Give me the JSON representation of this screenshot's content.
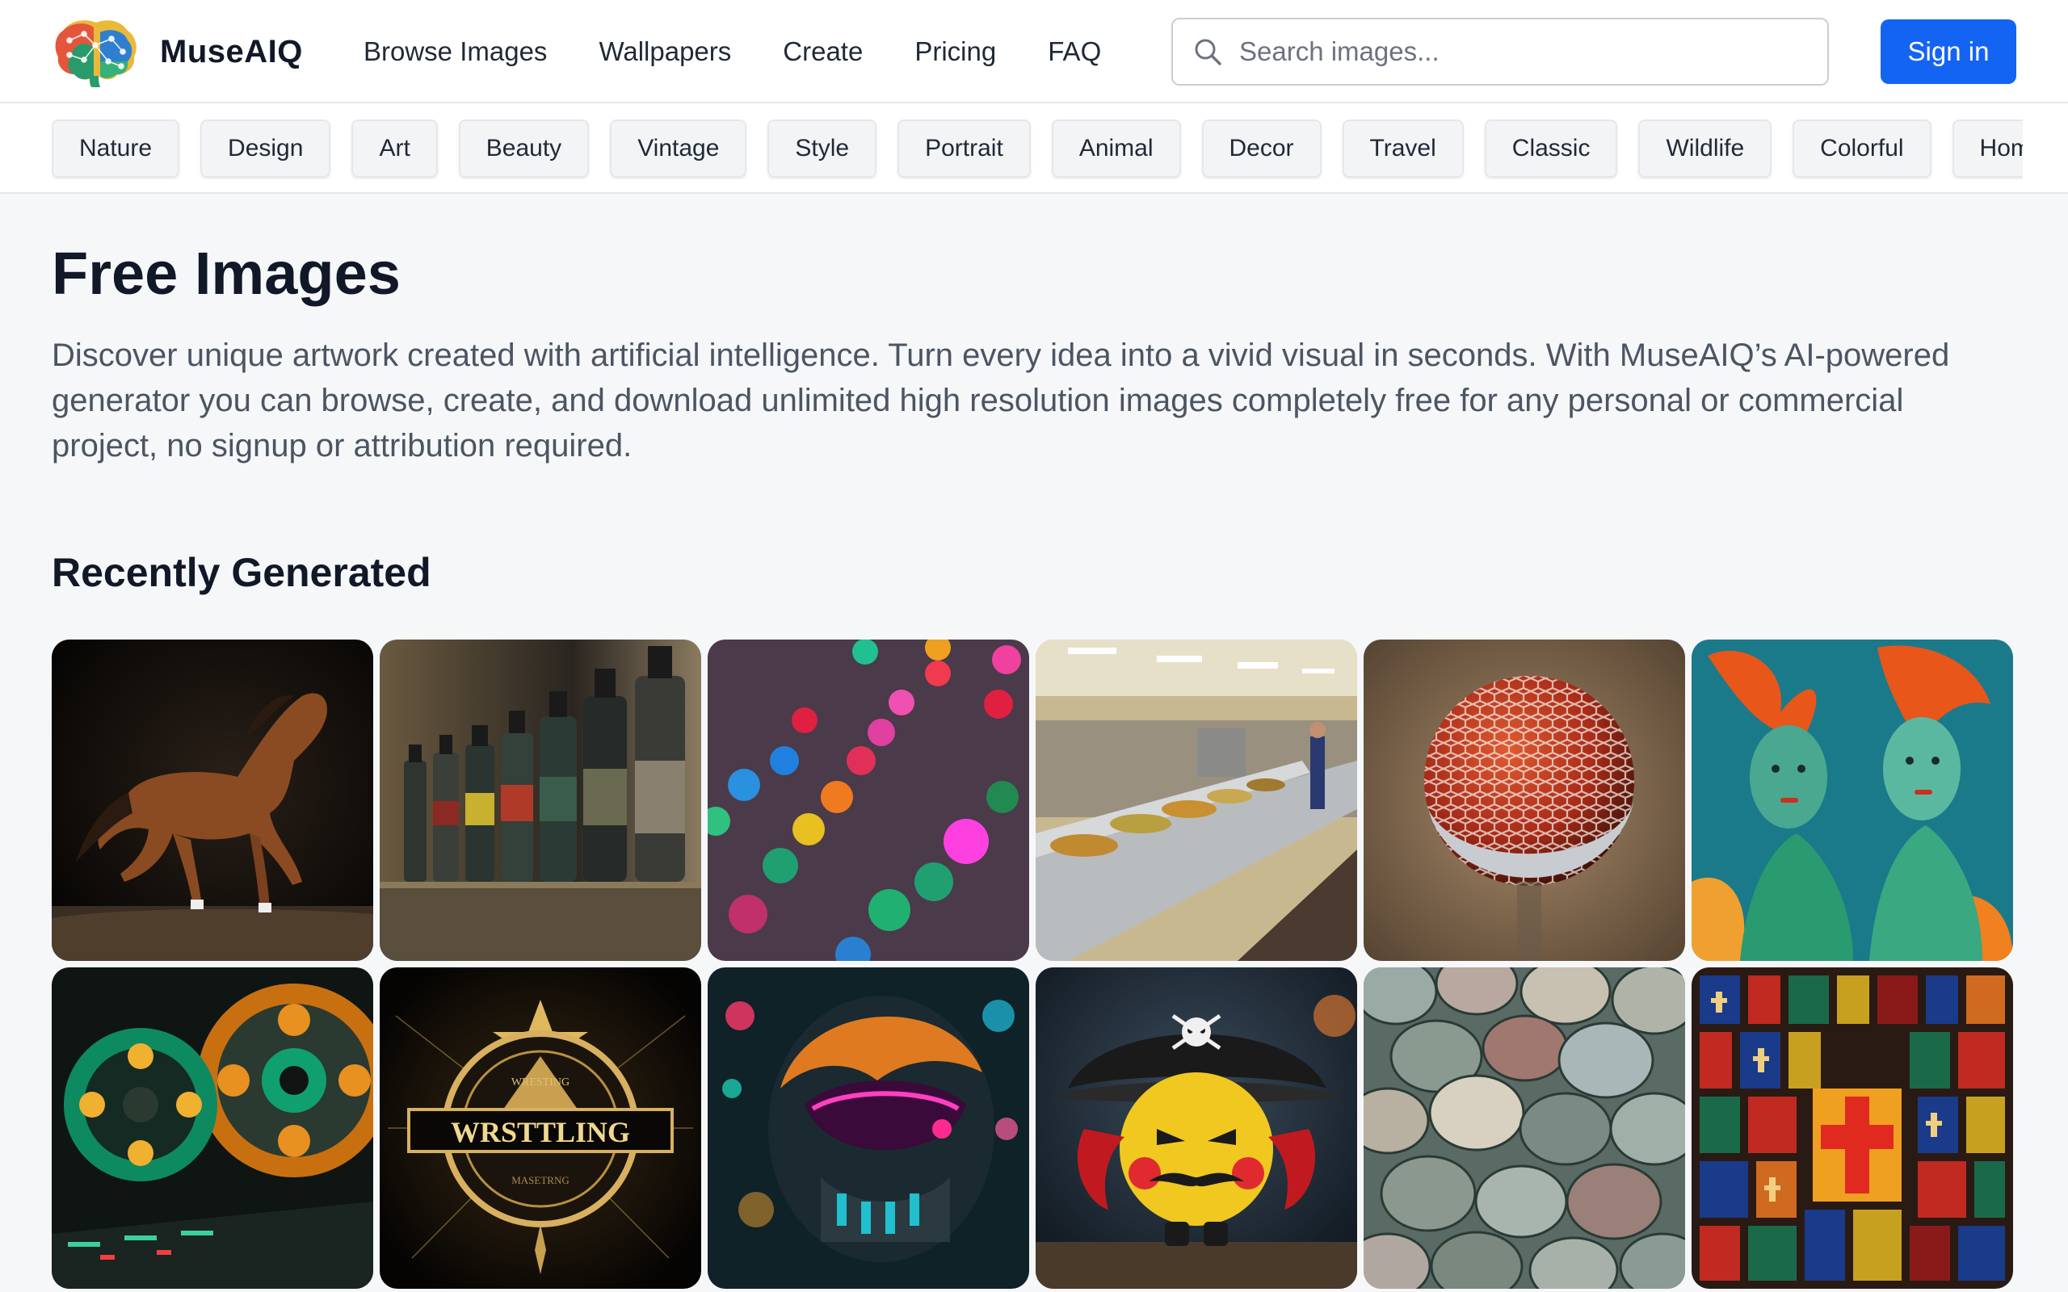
{
  "header": {
    "brand": "MuseAIQ",
    "nav": [
      "Browse Images",
      "Wallpapers",
      "Create",
      "Pricing",
      "FAQ"
    ],
    "search_placeholder": "Search images...",
    "signin_label": "Sign in",
    "accent": "#1464f4"
  },
  "categories": [
    "Nature",
    "Design",
    "Art",
    "Beauty",
    "Vintage",
    "Style",
    "Portrait",
    "Animal",
    "Decor",
    "Travel",
    "Classic",
    "Wildlife",
    "Colorful",
    "Hom"
  ],
  "main": {
    "title": "Free Images",
    "intro": "Discover unique artwork created with artificial intelligence. Turn every idea into a vivid visual in seconds. With MuseAIQ’s AI-powered generator you can browse, create, and download unlimited high resolution images completely free for any personal or commercial project, no signup or attribution required.",
    "section_title": "Recently Generated"
  },
  "gallery": [
    {
      "subject": "horse-galloping"
    },
    {
      "subject": "ink-bottles-on-shelf"
    },
    {
      "subject": "numbered-glowing-balls"
    },
    {
      "subject": "cafeteria-buffet"
    },
    {
      "subject": "red-glass-orb"
    },
    {
      "subject": "coral-mermaids"
    },
    {
      "subject": "film-reels"
    },
    {
      "subject": "wrestling-emblem",
      "text": "WRSTTLING",
      "arc_top": "WRESTING",
      "arc_bottom": "MASETRNG"
    },
    {
      "subject": "neon-astronaut-helmet"
    },
    {
      "subject": "pirate-emoji"
    },
    {
      "subject": "pastel-discs"
    },
    {
      "subject": "stained-glass-crosses"
    }
  ]
}
